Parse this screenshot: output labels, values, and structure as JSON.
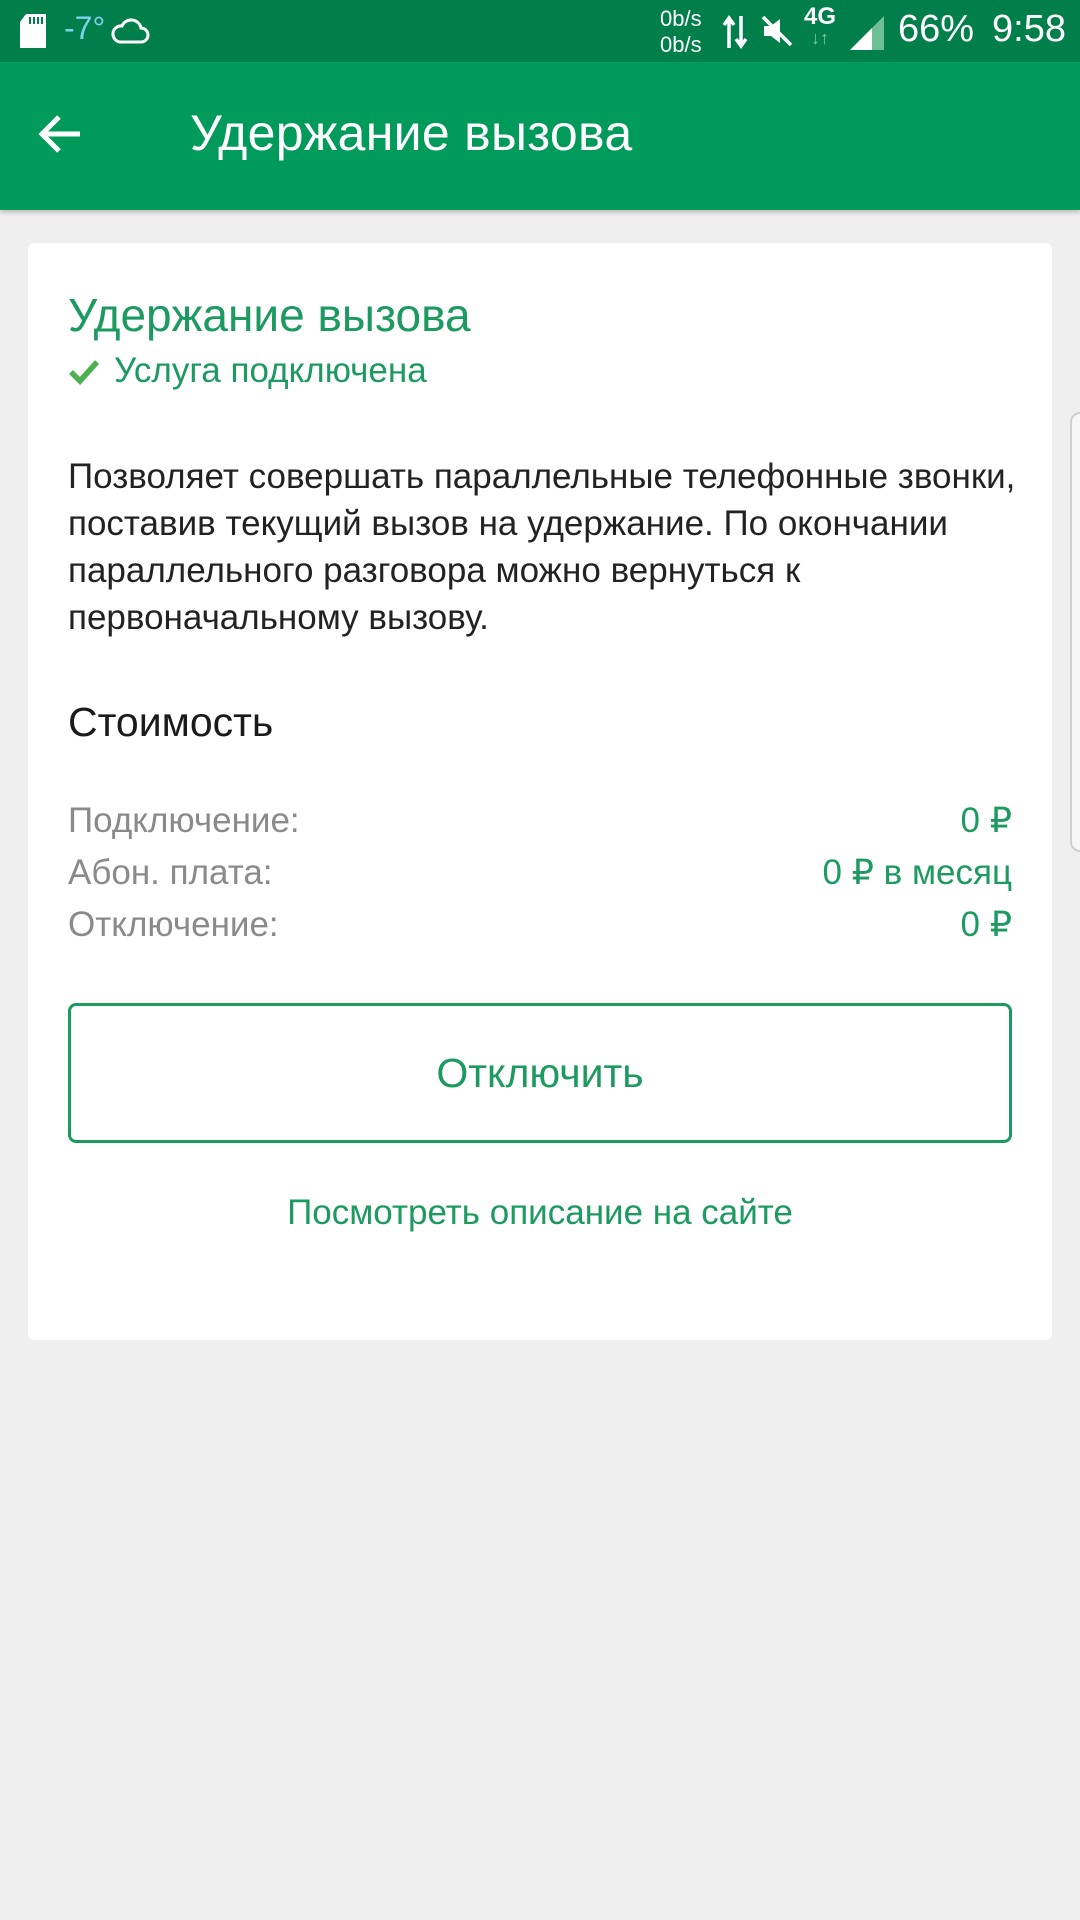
{
  "status_bar": {
    "temperature": "-7°",
    "speed_up": "0b/s",
    "speed_down": "0b/s",
    "network": "4G",
    "network_arrows": "↓↑",
    "battery": "66%",
    "time": "9:58"
  },
  "toolbar": {
    "title": "Удержание вызова"
  },
  "service": {
    "title": "Удержание вызова",
    "status": "Услуга подключена",
    "description": "Позволяет совершать параллельные телефонные звонки, поставив текущий вызов на удержание. По окончании параллельного разговора можно вернуться к первоначальному вызову."
  },
  "cost": {
    "heading": "Стоимость",
    "rows": [
      {
        "label": "Подключение:",
        "value": "0 ₽"
      },
      {
        "label": "Абон. плата:",
        "value": "0 ₽ в месяц"
      },
      {
        "label": "Отключение:",
        "value": "0 ₽"
      }
    ]
  },
  "actions": {
    "disconnect_label": "Отключить",
    "site_link_label": "Посмотреть описание на сайте"
  },
  "colors": {
    "status_bar": "#007f4a",
    "toolbar": "#009a5a",
    "accent": "#1d9a60",
    "background": "#efefef"
  }
}
